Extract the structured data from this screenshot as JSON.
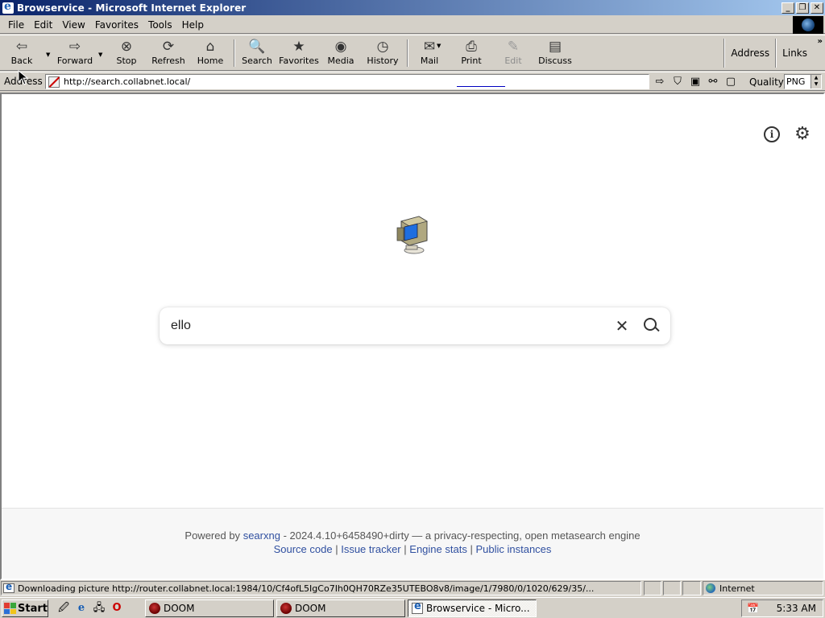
{
  "window": {
    "title": "Browservice - Microsoft Internet Explorer",
    "buttons": {
      "minimize": "_",
      "maximize": "❐",
      "close": "✕"
    }
  },
  "menubar": {
    "items": [
      {
        "label": "File"
      },
      {
        "label": "Edit"
      },
      {
        "label": "View"
      },
      {
        "label": "Favorites"
      },
      {
        "label": "Tools"
      },
      {
        "label": "Help"
      }
    ]
  },
  "toolbar": {
    "back": "Back",
    "forward": "Forward",
    "stop": "Stop",
    "refresh": "Refresh",
    "home": "Home",
    "search": "Search",
    "favorites": "Favorites",
    "media": "Media",
    "history": "History",
    "mail": "Mail",
    "print": "Print",
    "edit": "Edit",
    "discuss": "Discuss",
    "address_link": "Address",
    "links": "Links",
    "more": "»"
  },
  "addressbar": {
    "label": "Address",
    "url": "http://search.collabnet.local/",
    "quality_label": "Quality",
    "quality_value": "PNG"
  },
  "page": {
    "search_query": "ello",
    "footer": {
      "powered_by": "Powered by",
      "engine_name": "searxng",
      "version_text": "- 2024.4.10+6458490+dirty — a privacy-respecting, open metasearch engine",
      "links": [
        "Source code",
        "Issue tracker",
        "Engine stats",
        "Public instances"
      ],
      "separator": "|"
    }
  },
  "statusbar": {
    "message": "Downloading picture http://router.collabnet.local:1984/10/Cf4ofL5IgCo7Ih0QH70RZe35UTEBO8v8/image/1/7980/0/1020/629/35/...",
    "zone": "Internet"
  },
  "taskbar": {
    "start": "Start",
    "tasks": [
      {
        "label": "DOOM"
      },
      {
        "label": "DOOM"
      },
      {
        "label": "Browservice - Micro..."
      }
    ],
    "clock": "5:33 AM"
  },
  "colors": {
    "titlebar_start": "#0a246a",
    "titlebar_end": "#a6caf0",
    "chrome": "#d4d0c8",
    "link": "#3050a0"
  }
}
